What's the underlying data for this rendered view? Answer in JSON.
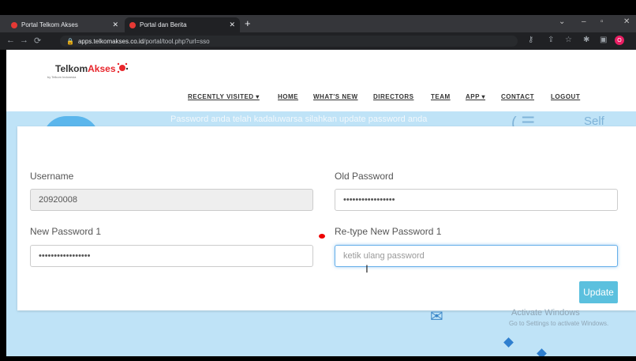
{
  "browser": {
    "tabs": [
      {
        "title": "Portal Telkom Akses",
        "close": "✕"
      },
      {
        "title": "Portal dan Berita",
        "close": "✕"
      }
    ],
    "new_tab": "+",
    "url_domain": "apps.telkomakses.co.id",
    "url_path": "/portal/tool.php?url=sso",
    "profile_initial": "O"
  },
  "site": {
    "logo_main": "Telkom",
    "logo_accent": "Akses",
    "logo_sub": "by Telkom Indonesia",
    "nav": [
      "RECENTLY VISITED ▾",
      "HOME",
      "WHAT'S NEW",
      "DIRECTORS",
      "TEAM",
      "APP ▾",
      "CONTACT",
      "LOGOUT"
    ]
  },
  "banner": {
    "message": "Password anda telah kadaluwarsa silahkan update password anda",
    "self_service": "Self Servic"
  },
  "form": {
    "username_label": "Username",
    "username_value": "20920008",
    "old_password_label": "Old Password",
    "old_password_value": "•••••••••••••••••",
    "new_password_label": "New Password 1",
    "new_password_value": "•••••••••••••••••",
    "retype_label": "Re-type New Password 1",
    "retype_placeholder": "ketik ulang password",
    "update_label": "Update"
  },
  "watermark": {
    "title": "Activate Windows",
    "subtitle": "Go to Settings to activate Windows."
  },
  "colors": {
    "update_button": "#5bc0de",
    "hero_bg": "#bfe3f7",
    "logo_red": "#e8262c"
  }
}
